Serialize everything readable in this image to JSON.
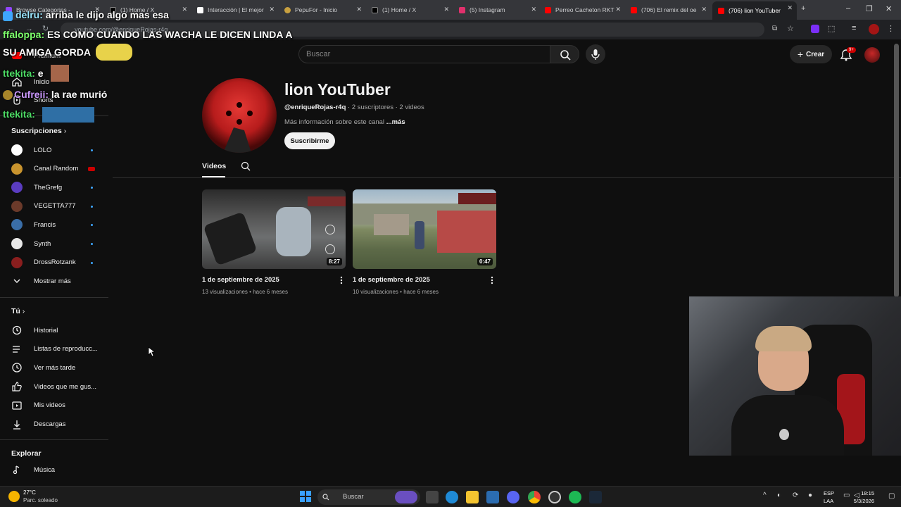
{
  "browser": {
    "tabs": [
      {
        "title": "Browse Categories -",
        "color": "#9146ff"
      },
      {
        "title": "(1) Home / X",
        "color": "#000000"
      },
      {
        "title": "Interacción | El mejor",
        "color": "#ffffff"
      },
      {
        "title": "PepuFor - Inicio",
        "color": "#c8a040"
      },
      {
        "title": "(1) Home / X",
        "color": "#000000"
      },
      {
        "title": "(5) Instagram",
        "color": "#e1306c"
      },
      {
        "title": "Perreo Cacheton RKT",
        "color": "#ff0000"
      },
      {
        "title": "(706) El remix del oe",
        "color": "#ff0000"
      },
      {
        "title": "(706) lion YouTuber",
        "color": "#ff0000"
      }
    ],
    "url": "youtube.com/@enriqueRojas-r4q"
  },
  "header": {
    "search_placeholder": "Buscar",
    "create_label": "Crear",
    "notif_count": "9+"
  },
  "sidebar": {
    "top_items": [
      {
        "label": "Premium",
        "icon": "youtube-logo-icon"
      },
      {
        "label": "Inicio",
        "icon": "home-icon"
      },
      {
        "label": "Shorts",
        "icon": "shorts-icon"
      }
    ],
    "subs_heading": "Suscripciones",
    "subscriptions": [
      {
        "label": "LOLO",
        "color": "#ffffff",
        "indicator": "dot"
      },
      {
        "label": "Canal Random",
        "color": "#c9942e",
        "indicator": "live"
      },
      {
        "label": "TheGrefg",
        "color": "#5a3cc0",
        "indicator": "dot"
      },
      {
        "label": "VEGETTA777",
        "color": "#6b3a2a",
        "indicator": "dot"
      },
      {
        "label": "Francis",
        "color": "#3a6ea8",
        "indicator": "dot"
      },
      {
        "label": "Synth",
        "color": "#e8e8e8",
        "indicator": "dot"
      },
      {
        "label": "DrossRotzank",
        "color": "#8a1e1e",
        "indicator": "dot"
      }
    ],
    "show_more": "Mostrar más",
    "you_heading": "Tú",
    "you_items": [
      {
        "label": "Historial",
        "icon": "history-icon"
      },
      {
        "label": "Listas de reproducc...",
        "icon": "playlist-icon"
      },
      {
        "label": "Ver más tarde",
        "icon": "watch-later-icon"
      },
      {
        "label": "Videos que me gus...",
        "icon": "like-icon"
      },
      {
        "label": "Mis videos",
        "icon": "my-videos-icon"
      },
      {
        "label": "Descargas",
        "icon": "download-icon"
      }
    ],
    "explore_heading": "Explorar",
    "explore_items": [
      {
        "label": "Música",
        "icon": "music-icon"
      }
    ]
  },
  "channel": {
    "name": "lion YouTuber",
    "handle": "@enriqueRojas-r4q",
    "stats": "· 2 suscriptores · 2 videos",
    "desc": "Más información sobre este canal",
    "desc_more": "...más",
    "subscribe_label": "Suscribirme",
    "tab_label": "Videos"
  },
  "videos": [
    {
      "title": "1 de septiembre de 2025",
      "views": "13 visualizaciones",
      "age": "hace 6 meses",
      "duration": "8:27"
    },
    {
      "title": "1 de septiembre de 2025",
      "views": "10 visualizaciones",
      "age": "hace 6 meses",
      "duration": "0:47"
    }
  ],
  "chat": [
    {
      "name": "delru:",
      "text": "arriba le dijo algo mas esa"
    },
    {
      "name": "ffaloppa:",
      "text": "ES COMO CUANDO LAS WACHA LE DICEN LINDA A"
    },
    {
      "name": "",
      "text": "SU AMIGA GORDA"
    },
    {
      "name": "ttekita:",
      "text": "e"
    },
    {
      "name": "Cufreii:",
      "text": "la rae murió"
    },
    {
      "name": "ttekita:",
      "text": ""
    }
  ],
  "taskbar": {
    "temp": "27°C",
    "weather": "Parc. soleado",
    "search": "Buscar",
    "lang1": "ESP",
    "lang2": "LAA",
    "time": "18:15",
    "date": "5/3/2026"
  }
}
